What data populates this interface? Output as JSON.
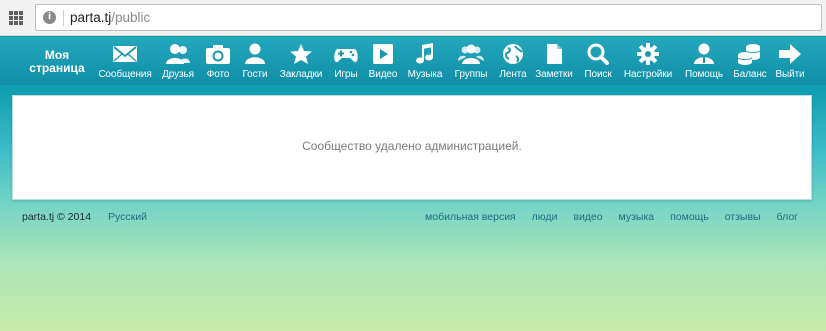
{
  "browser": {
    "url_host": "parta.tj",
    "url_path": "/public"
  },
  "nav": {
    "brand": "Моя страница",
    "items": [
      {
        "label": "Сообщения",
        "icon": "envelope-icon"
      },
      {
        "label": "Друзья",
        "icon": "friends-icon"
      },
      {
        "label": "Фото",
        "icon": "camera-icon"
      },
      {
        "label": "Гости",
        "icon": "guest-icon"
      },
      {
        "label": "Закладки",
        "icon": "star-icon"
      },
      {
        "label": "Игры",
        "icon": "gamepad-icon"
      },
      {
        "label": "Видео",
        "icon": "play-icon"
      },
      {
        "label": "Музыка",
        "icon": "music-note-icon"
      },
      {
        "label": "Группы",
        "icon": "group-icon"
      },
      {
        "label": "Лента",
        "icon": "globe-icon"
      },
      {
        "label": "Заметки",
        "icon": "document-icon"
      },
      {
        "label": "Поиск",
        "icon": "magnifier-icon"
      },
      {
        "label": "Настройки",
        "icon": "gear-icon"
      },
      {
        "label": "Помощь",
        "icon": "help-person-icon"
      },
      {
        "label": "Баланс",
        "icon": "coins-icon"
      },
      {
        "label": "Выйти",
        "icon": "arrow-right-icon"
      }
    ]
  },
  "main": {
    "message": "Сообщество удалено администрацией."
  },
  "footer": {
    "copyright": "parta.tj © 2014",
    "language": "Русский",
    "links": [
      "мобильная версия",
      "люди",
      "видео",
      "музыка",
      "помощь",
      "отзывы",
      "блог"
    ]
  }
}
